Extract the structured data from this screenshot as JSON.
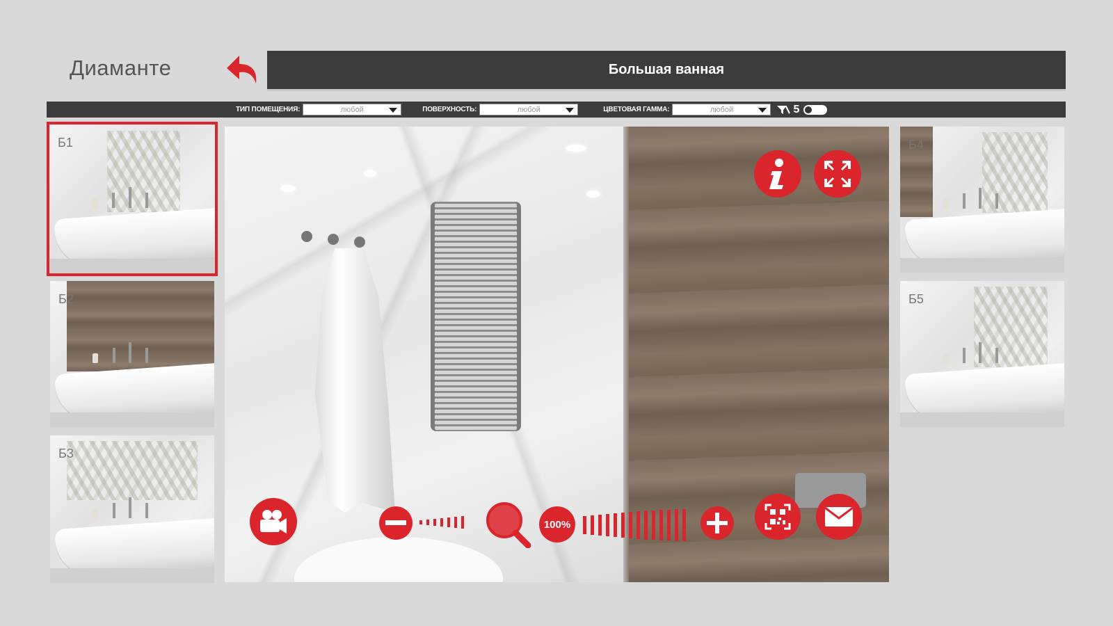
{
  "app": {
    "brand": "Диаманте"
  },
  "header": {
    "title": "Большая ванная"
  },
  "filters": [
    {
      "label": "ТИП ПОМЕЩЕНИЯ:",
      "value": "любой"
    },
    {
      "label": "ПОВЕРХНОСТЬ:",
      "value": "любой"
    },
    {
      "label": "ЦВЕТОВАЯ ГАММА:",
      "value": "любой"
    }
  ],
  "filter_count": "5",
  "thumbnails_left": [
    {
      "label": "Б1",
      "selected": true,
      "wall": "white-deco"
    },
    {
      "label": "Б2",
      "selected": false,
      "wall": "wood"
    },
    {
      "label": "Б3",
      "selected": false,
      "wall": "white-deco"
    }
  ],
  "thumbnails_right": [
    {
      "label": "Б4",
      "wall": "white-deco"
    },
    {
      "label": "Б5",
      "wall": "white-deco"
    }
  ],
  "viewer": {
    "zoom_label": "100%",
    "icons": {
      "info": "info-icon",
      "fullscreen": "fullscreen-icon",
      "video": "video-camera-icon",
      "zoom_out": "minus-icon",
      "zoom": "magnifier-icon",
      "zoom_in": "plus-icon",
      "qr": "qr-code-icon",
      "mail": "mail-icon"
    }
  },
  "colors": {
    "accent": "#d9252b",
    "bar": "#3c3c3c",
    "background": "#d9d9d9"
  }
}
